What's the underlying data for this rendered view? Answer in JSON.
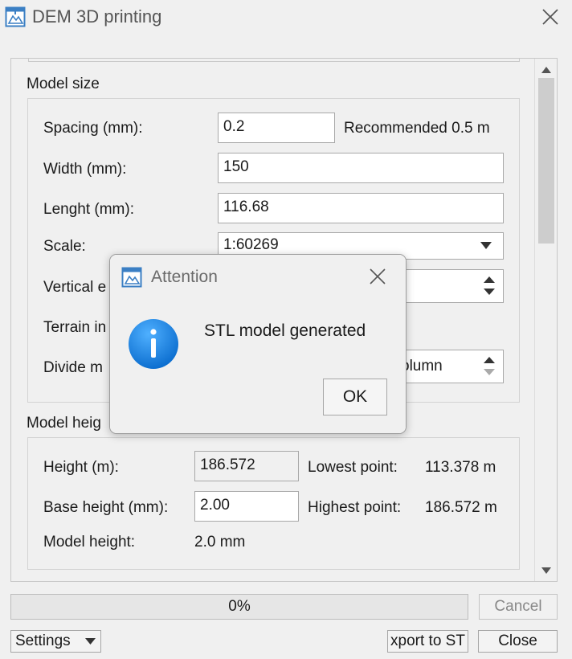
{
  "window": {
    "title": "DEM 3D printing",
    "icon": "app-printer-icon",
    "close_icon": "close-icon"
  },
  "model_size": {
    "group_label": "Model size",
    "spacing": {
      "label": "Spacing (mm):",
      "value": "0.2",
      "recommended": "Recommended  0.5 m"
    },
    "width": {
      "label": "Width (mm):",
      "value": "150"
    },
    "length": {
      "label": "Lenght (mm):",
      "value": "116.68"
    },
    "scale": {
      "label": "Scale:",
      "value": "1:60269"
    },
    "vertical": {
      "label": "Vertical e"
    },
    "terrain": {
      "label": "Terrain in"
    },
    "divide": {
      "label": "Divide m",
      "value": "olumn"
    }
  },
  "model_height": {
    "group_label": "Model heig",
    "height": {
      "label": "Height (m):",
      "value": "186.572"
    },
    "lowest": {
      "label": "Lowest point:",
      "value": "113.378 m"
    },
    "base_height": {
      "label": "Base height (mm):",
      "value": "2.00"
    },
    "highest": {
      "label": "Highest point:",
      "value": "186.572 m"
    },
    "model_height": {
      "label": "Model height:",
      "value": "2.0 mm"
    }
  },
  "dialog": {
    "title": "Attention",
    "message": "STL model generated",
    "ok": "OK",
    "icon": "info-icon",
    "accent": "#1e7fd8"
  },
  "bottom": {
    "progress_text": "0%",
    "progress": 0,
    "cancel": "Cancel",
    "settings": "Settings",
    "export": "xport to ST",
    "close": "Close"
  }
}
